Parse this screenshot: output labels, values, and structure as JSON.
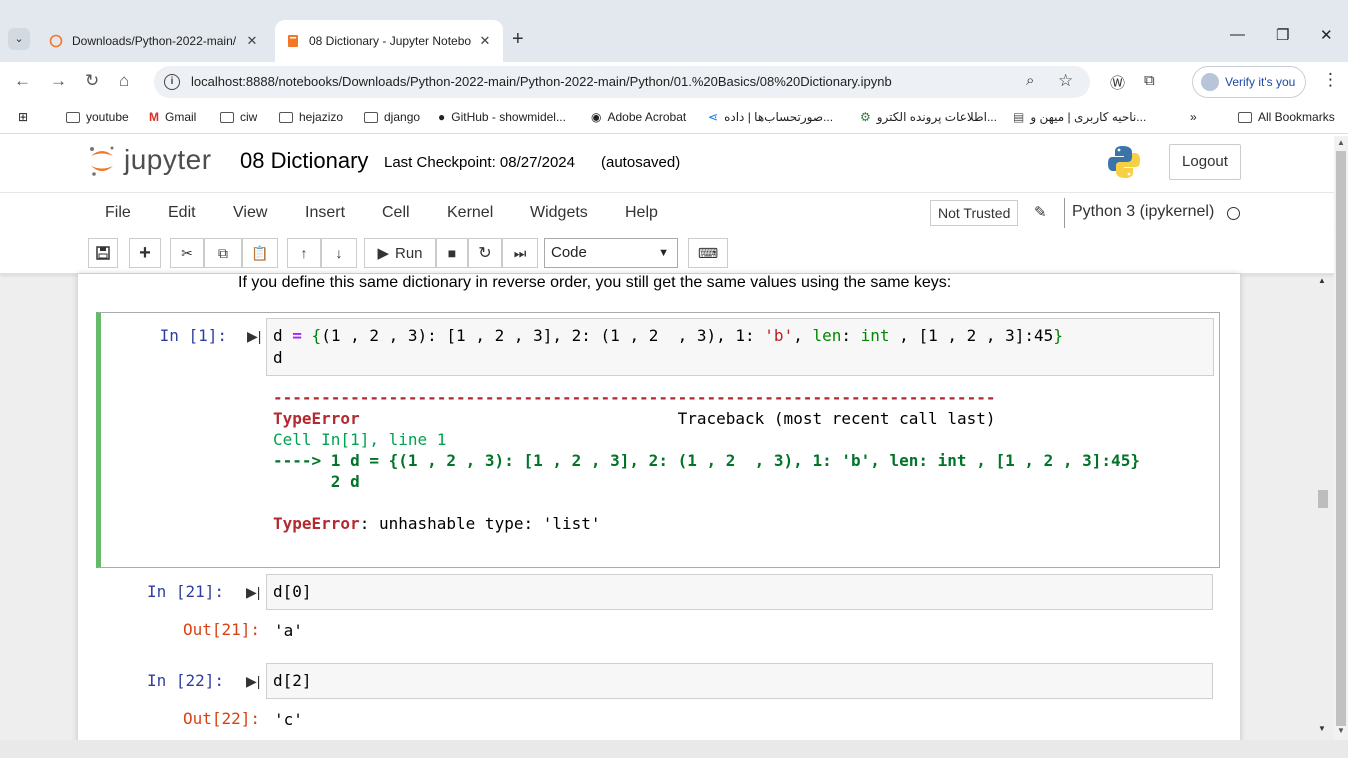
{
  "browser": {
    "tabs": [
      {
        "title": "Downloads/Python-2022-main/",
        "active": false
      },
      {
        "title": "08 Dictionary - Jupyter Notebo",
        "active": true
      }
    ],
    "url": "localhost:8888/notebooks/Downloads/Python-2022-main/Python-2022-main/Python/01.%20Basics/08%20Dictionary.ipynb",
    "verify_label": "Verify it's you",
    "bookmarks": [
      "youtube",
      "Gmail",
      "ciw",
      "hejazizo",
      "django",
      "GitHub - showmidel...",
      "Adobe Acrobat",
      "صورتحساب‌ها | داده...",
      "اطلاعات پرونده الکترو...",
      "ناحیه کاربری | میهن و..."
    ],
    "all_bookmarks": "All Bookmarks"
  },
  "jupyter": {
    "logo_text": "jupyter",
    "notebook_name": "08 Dictionary",
    "checkpoint": "Last Checkpoint: 08/27/2024",
    "autosaved": "(autosaved)",
    "logout": "Logout",
    "menu": [
      "File",
      "Edit",
      "View",
      "Insert",
      "Cell",
      "Kernel",
      "Widgets",
      "Help"
    ],
    "not_trusted": "Not Trusted",
    "kernel": "Python 3 (ipykernel)",
    "run_label": "Run",
    "cell_type": "Code"
  },
  "notebook": {
    "markdown_text": "If you define this same dictionary in reverse order, you still get the same values using the same keys:",
    "cell1": {
      "prompt": "In [1]:",
      "input_line2": "d",
      "error": {
        "dashes": "---------------------------------------------------------------------------",
        "name": "TypeError",
        "traceback_label": "Traceback (most recent call last)",
        "cell_ref": "Cell In[1], line 1",
        "arrow_line": "----> 1 d = {(1 , 2 , 3): [1 , 2 , 3], 2: (1 , 2  , 3), 1: 'b', len: int , [1 , 2 , 3]:45}",
        "line2": "      2 d",
        "message": ": unhashable type: 'list'"
      }
    },
    "cell2": {
      "prompt": "In [21]:",
      "input": "d[0]",
      "out_prompt": "Out[21]:",
      "output": "'a'"
    },
    "cell3": {
      "prompt": "In [22]:",
      "input": "d[2]",
      "out_prompt": "Out[22]:",
      "output": "'c'"
    }
  }
}
